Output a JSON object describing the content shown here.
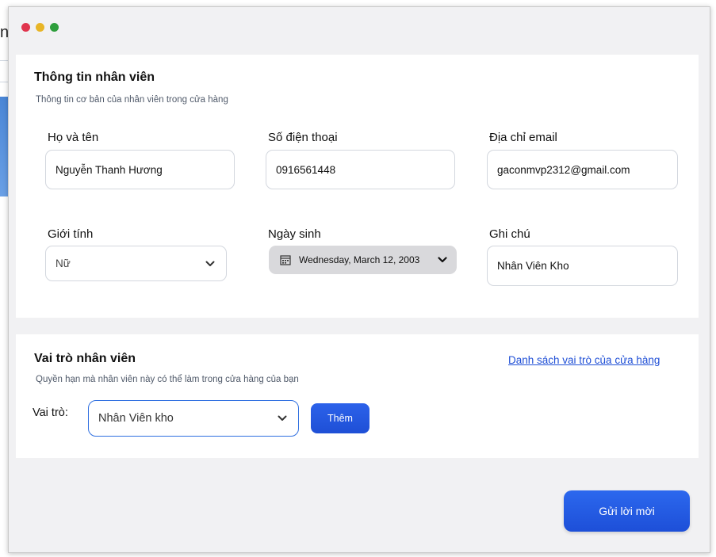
{
  "background": {
    "partial_title": "n"
  },
  "employee_info": {
    "title": "Thông tin nhân viên",
    "subtitle": "Thông tin cơ bản của nhân viên trong cửa hàng",
    "full_name": {
      "label": "Họ và tên",
      "value": "Nguyễn Thanh Hương"
    },
    "phone": {
      "label": "Số điện thoại",
      "value": "0916561448"
    },
    "email": {
      "label": "Địa chỉ email",
      "value": "gaconmvp2312@gmail.com"
    },
    "gender": {
      "label": "Giới tính",
      "value": "Nữ"
    },
    "birthday": {
      "label": "Ngày sinh",
      "value": "Wednesday, March 12, 2003"
    },
    "note": {
      "label": "Ghi chú",
      "value": "Nhân Viên Kho"
    }
  },
  "role_section": {
    "title": "Vai trò nhân viên",
    "subtitle": "Quyền hạn mà nhân viên này có thể làm trong cửa hàng của bạn",
    "store_roles_link": "Danh sách vai trò của cửa hàng",
    "role_label": "Vai trò:",
    "role_value": "Nhân Viên kho",
    "add_button": "Thêm"
  },
  "footer": {
    "send_invite_button": "Gửi lời mời"
  },
  "colors": {
    "accent": "#1f4fd6",
    "window_bg": "#f1f1f3",
    "dot_red": "#e0354d",
    "dot_yellow": "#e8b526",
    "dot_green": "#2e9e3c"
  },
  "icons": {
    "dropdown": "chevron-down-icon",
    "calendar": "calendar-icon"
  }
}
